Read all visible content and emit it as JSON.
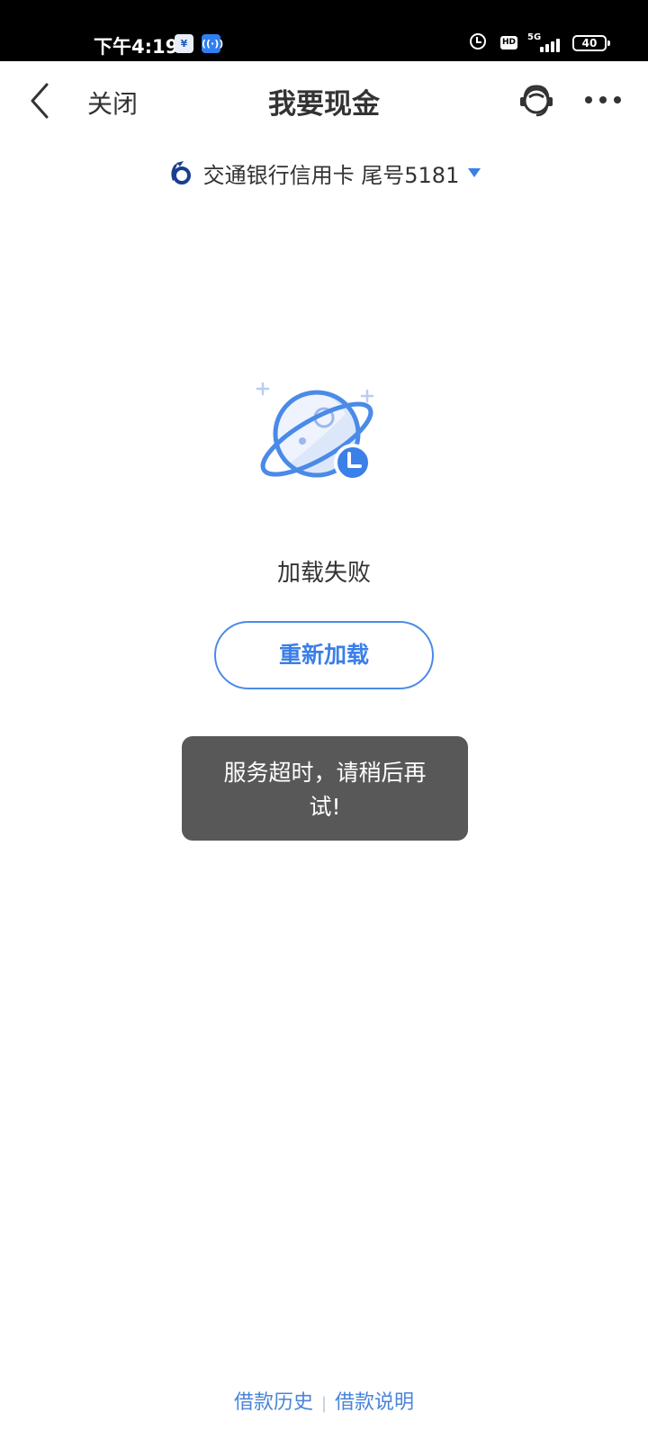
{
  "status_bar": {
    "time": "下午4:19",
    "network": "5G",
    "hd": "HD",
    "battery": "40"
  },
  "nav": {
    "close_label": "关闭",
    "title": "我要现金"
  },
  "card": {
    "label": "交通银行信用卡 尾号5181"
  },
  "error": {
    "message": "加载失败",
    "reload_label": "重新加载"
  },
  "toast": {
    "text": "服务超时，请稍后再试!"
  },
  "footer": {
    "history_label": "借款历史",
    "separator": "|",
    "instructions_label": "借款说明"
  },
  "colors": {
    "accent": "#3b7fe8",
    "toast_bg": "#585858",
    "status_bar_bg": "#000000"
  },
  "icons": [
    "back-icon",
    "customer-service-icon",
    "more-icon",
    "bank-logo-icon",
    "dropdown-icon",
    "planet-clock-icon",
    "alarm-icon",
    "signal-icon",
    "battery-icon"
  ]
}
